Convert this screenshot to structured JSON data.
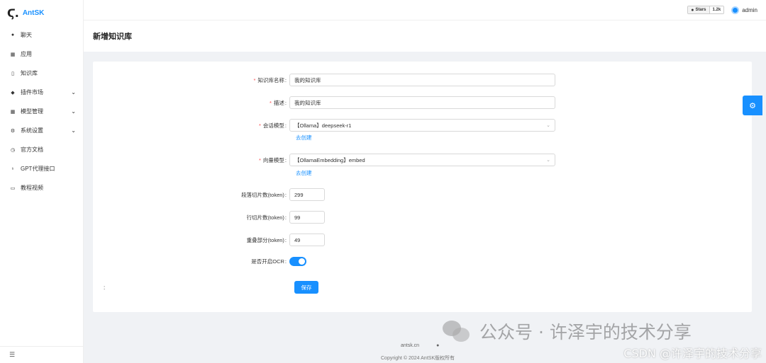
{
  "app": {
    "logo_mark": "Ϛ.",
    "name": "AntSK"
  },
  "sidebar": {
    "items": [
      {
        "label": "聊天",
        "icon": "chat-icon",
        "glyph": "●",
        "has_children": false
      },
      {
        "label": "应用",
        "icon": "apps-icon",
        "glyph": "▦",
        "has_children": false
      },
      {
        "label": "知识库",
        "icon": "book-icon",
        "glyph": "▯",
        "has_children": false
      },
      {
        "label": "插件市场",
        "icon": "dropbox-icon",
        "glyph": "◆",
        "has_children": true
      },
      {
        "label": "模型管理",
        "icon": "grid-icon",
        "glyph": "▦",
        "has_children": true
      },
      {
        "label": "系统设置",
        "icon": "settings-icon",
        "glyph": "⚙",
        "has_children": true
      },
      {
        "label": "官方文档",
        "icon": "clock-icon",
        "glyph": "◷",
        "has_children": false
      },
      {
        "label": "GPT代理接口",
        "icon": "bulb-icon",
        "glyph": "♁",
        "has_children": false
      },
      {
        "label": "教程视频",
        "icon": "video-icon",
        "glyph": "▭",
        "has_children": false
      }
    ],
    "collapse_glyph": "☰"
  },
  "header": {
    "github": {
      "stars_label": "Stars",
      "count": "1.2k"
    },
    "user": "admin"
  },
  "page": {
    "title": "新增知识库"
  },
  "form": {
    "name": {
      "label": "知识库名称",
      "value": "我的知识库",
      "required": true
    },
    "description": {
      "label": "描述",
      "value": "我的知识库",
      "required": true
    },
    "chat_model": {
      "label": "会话模型",
      "value": "【Ollama】deepseek-r1",
      "required": true,
      "link": "去创建"
    },
    "embedding_model": {
      "label": "向量模型",
      "value": "【OllamaEmbedding】embed",
      "required": true,
      "link": "去创建"
    },
    "paragraph_tokens": {
      "label": "段落切片数(token)",
      "value": "299"
    },
    "line_tokens": {
      "label": "行切片数(token)",
      "value": "99"
    },
    "overlap_tokens": {
      "label": "重叠部分(token)",
      "value": "49"
    },
    "ocr": {
      "label": "是否开启OCR",
      "enabled": true
    },
    "save_label": "保存",
    "stray_colon": ":"
  },
  "footer": {
    "link": "antsk.cn",
    "copyright": "Copyright © 2024 AntSK版权所有"
  },
  "watermark": {
    "text": "公众号 · 许泽宇的技术分享",
    "csdn": "CSDN @许泽宇的技术分享"
  },
  "colors": {
    "accent": "#1890ff",
    "required": "#ff4d4f"
  }
}
